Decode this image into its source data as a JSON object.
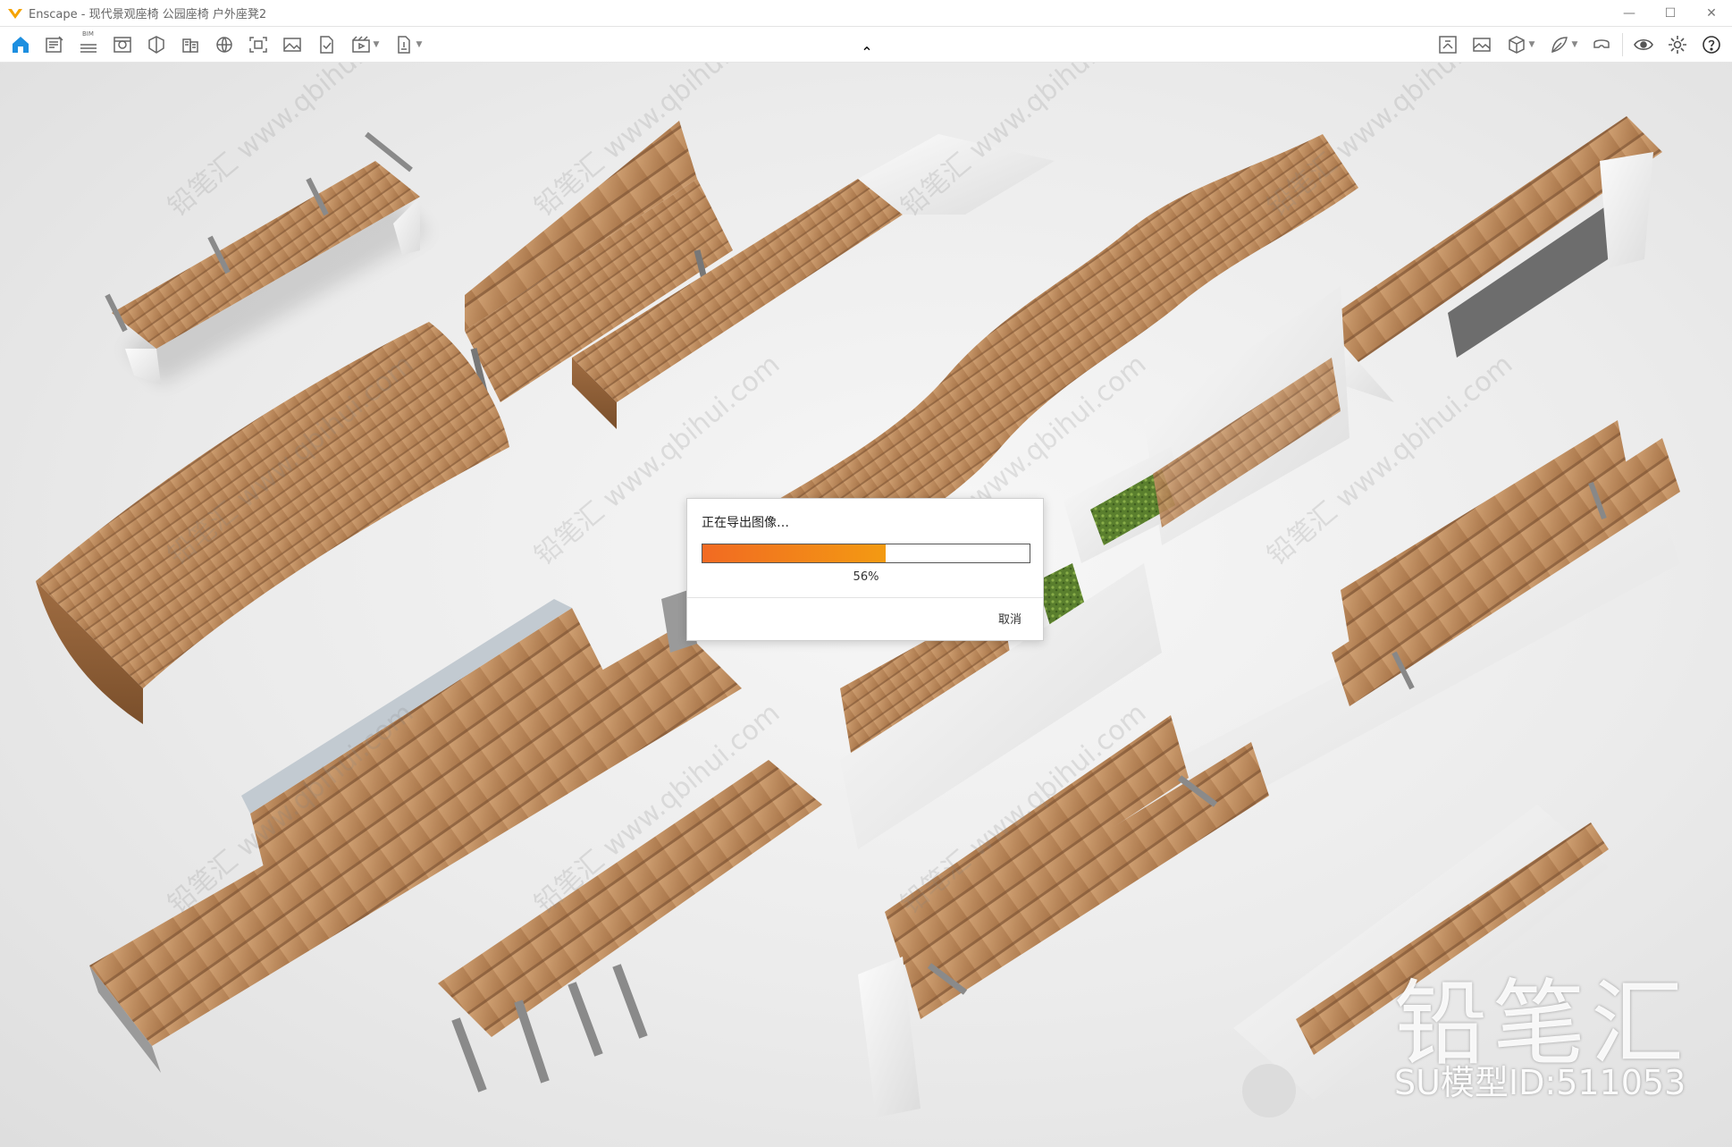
{
  "window": {
    "app_name": "Enscape",
    "title_separator": " - ",
    "document": "现代景观座椅 公园座椅 户外座凳2",
    "controls": {
      "minimize": "—",
      "maximize": "☐",
      "close": "✕"
    }
  },
  "toolbar": {
    "left_icons": [
      {
        "id": "home-icon",
        "caret": false
      },
      {
        "id": "views-icon",
        "caret": false
      },
      {
        "id": "bim-icon",
        "caret": false,
        "badge": "BIM"
      },
      {
        "id": "visual-settings-icon",
        "caret": false
      },
      {
        "id": "asset-library-icon",
        "caret": false
      },
      {
        "id": "material-editor-icon",
        "caret": false
      },
      {
        "id": "site-context-icon",
        "caret": false
      },
      {
        "id": "capture-screenshot-icon",
        "caret": false
      },
      {
        "id": "image-gallery-icon",
        "caret": false
      },
      {
        "id": "batch-render-icon",
        "caret": false
      },
      {
        "id": "video-editor-icon",
        "caret": true
      },
      {
        "id": "export-icon",
        "caret": true
      }
    ],
    "right_icons": [
      {
        "id": "sync-views-icon",
        "caret": false
      },
      {
        "id": "panorama-icon",
        "caret": false
      },
      {
        "id": "cube-icon",
        "caret": true
      },
      {
        "id": "feather-icon",
        "caret": true
      },
      {
        "id": "vr-headset-icon",
        "caret": false
      },
      {
        "id": "eye-icon",
        "caret": false
      },
      {
        "id": "settings-icon",
        "caret": false
      },
      {
        "id": "help-icon",
        "caret": false
      }
    ],
    "collapse_chevron": "⌃"
  },
  "dialog": {
    "title": "正在导出图像…",
    "progress": 0.56,
    "progress_label": "56%",
    "cancel_label": "取消"
  },
  "watermark": {
    "logo_text": "铅笔汇",
    "model_id": "SU模型ID:511053",
    "tile_text": "铅笔汇 www.qbihui.com"
  },
  "colors": {
    "accent_blue": "#1d8fe0",
    "logo_orange": "#f5a300",
    "progress_start": "#f26a22",
    "progress_end": "#f39a12",
    "wood_light": "#c79668",
    "wood_dark": "#8e5f37",
    "concrete": "#e9e9e9",
    "metal": "#9a9a9a"
  }
}
